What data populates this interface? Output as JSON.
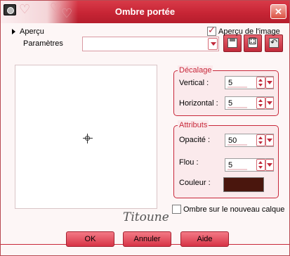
{
  "window": {
    "title": "Ombre portée"
  },
  "tree": {
    "preview_label": "Aperçu",
    "presets_label": "Paramètres"
  },
  "presets": {
    "selected": ""
  },
  "preview_checkbox": {
    "label": "Aperçu de l'image",
    "checked": true
  },
  "decalage": {
    "title": "Décalage",
    "vertical_label": "Vertical :",
    "vertical_value": "5",
    "horizontal_label": "Horizontal :",
    "horizontal_value": "5"
  },
  "attributs": {
    "title": "Attributs",
    "opacity_label": "Opacité :",
    "opacity_value": "50",
    "blur_label": "Flou :",
    "blur_value": "5",
    "color_label": "Couleur :",
    "color_value": "#4a160d"
  },
  "new_layer_checkbox": {
    "label": "Ombre sur le nouveau calque",
    "checked": false
  },
  "signature": "Titoune",
  "buttons": {
    "ok": "OK",
    "cancel": "Annuler",
    "help": "Aide"
  },
  "colors": {
    "accent": "#c8283a",
    "titlebar": "#c72535"
  }
}
